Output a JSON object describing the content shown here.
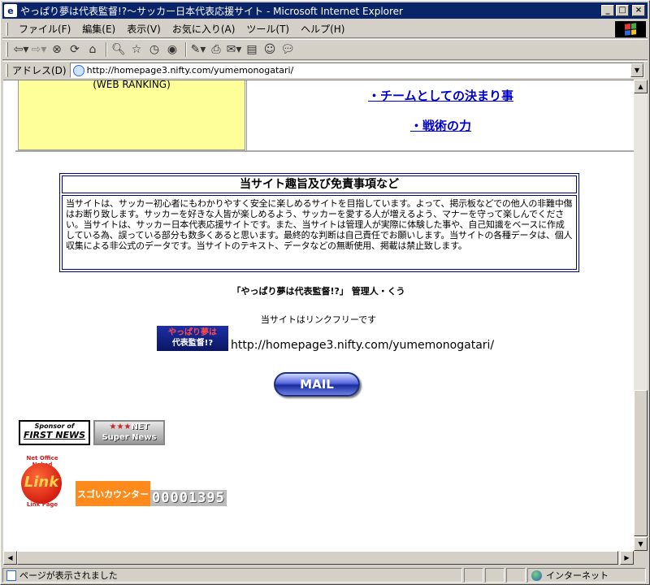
{
  "window": {
    "title": "やっぱり夢は代表監督!?～サッカー日本代表応援サイト - Microsoft Internet Explorer",
    "controls": {
      "minimize": "_",
      "maximize": "□",
      "close": "×"
    }
  },
  "menu": {
    "items": [
      "ファイル(F)",
      "編集(E)",
      "表示(V)",
      "お気に入り(A)",
      "ツール(T)",
      "ヘルプ(H)"
    ]
  },
  "toolbar": {
    "icons": [
      "back-icon",
      "forward-icon",
      "stop-icon",
      "refresh-icon",
      "home-icon",
      "search-icon",
      "favorites-icon",
      "history-icon",
      "media-icon",
      "edit-icon",
      "print-icon",
      "mail-icon",
      "discuss-icon",
      "messenger-icon"
    ]
  },
  "address": {
    "label": "アドレス(D)",
    "url": "http://homepage3.nifty.com/yumemonogatari/"
  },
  "page": {
    "ranking_text": "(WEB RANKING)",
    "links": [
      "・チームとしての決まり事",
      "・戦術の力"
    ],
    "disclaimer": {
      "heading": "当サイト趣旨及び免責事項など",
      "body": "当サイトは、サッカー初心者にもわかりやすく安全に楽しめるサイトを目指しています。よって、掲示板などでの他人の非難中傷はお断り致します。サッカーを好きな人皆が楽しめるよう、サッカーを愛する人が増えるよう、マナーを守って楽しんでください。当サイトは、サッカー日本代表応援サイトです。また、当サイトは管理人が実際に体験した事や、自己知識をベースに作成している為、誤っている部分も数多くあると思います。最終的な判断は自己責任でお願いします。当サイトの各種データは、個人収集による非公式のデータです。当サイトのテキスト、データなどの無断使用、掲載は禁止致します。"
    },
    "manager": "「やっぱり夢は代表監督!?」 管理人・くう",
    "link_free": "当サイトはリンクフリーです",
    "banner": {
      "line1": "やっぱり夢は",
      "line2": "代表監督!?"
    },
    "site_url": "http://homepage3.nifty.com/yumemonogatari/",
    "mail_button": "MAIL",
    "sponsor_badge": {
      "line1": "Sponsor of",
      "line2": "FIRST NEWS"
    },
    "net_badge": {
      "stars": "★★★",
      "line1": "NET",
      "line2": "Super News"
    },
    "link_logo": {
      "top": "Net Office Naked",
      "center": "Link",
      "bottom": "Link Page"
    },
    "counter": {
      "label": "スゴいカウンター",
      "value": "00001395"
    }
  },
  "status": {
    "text": "ページが表示されました",
    "zone": "インターネット"
  },
  "colors": {
    "titlebar": "#0a246a",
    "link": "#0000cc",
    "ranking_bg": "#ffff99",
    "counter_bg": "#ff8a1c"
  }
}
